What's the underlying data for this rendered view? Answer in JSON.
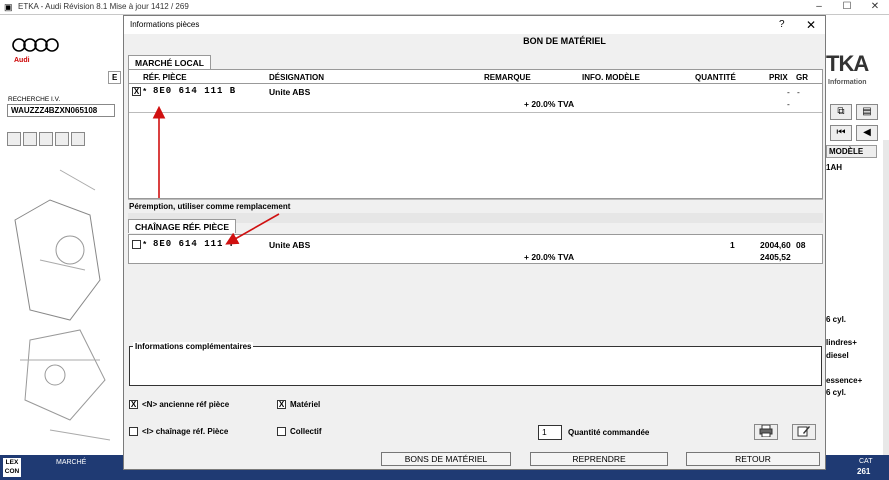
{
  "app": {
    "title": "ETKA - Audi Révision 8.1 Mise à jour 1412 / 269",
    "logo_text": "Audi",
    "search_label": "RECHERCHE I.V.",
    "vin_value": "WAUZZZ4BZXN065108",
    "tab_e": "E",
    "brand_partial": "TKA",
    "brand_sub": "Information",
    "model_col": "MODÈLE",
    "right_texts": [
      "1AH",
      "6 cyl.",
      "lindres+",
      "diesel",
      "essence+",
      "6 cyl."
    ],
    "bottom": {
      "lex": "LEX",
      "con": "CON",
      "marche": "MARCHÉ",
      "cat": "CAT",
      "cat_num": "261"
    }
  },
  "dialog": {
    "title": "Informations pièces",
    "help": "?",
    "close": "✕",
    "heading": "BON DE MATÉRIEL",
    "tab_local": "MARCHÉ LOCAL",
    "columns": {
      "ref": "RÉF. PIÈCE",
      "designation": "DÉSIGNATION",
      "remarque": "REMARQUE",
      "info": "INFO. MODÈLE",
      "quantite": "QUANTITÉ",
      "prix": "PRIX",
      "gr": "GR"
    },
    "row1": {
      "mark": "X",
      "star": "*",
      "ref": "8E0 614 111 B",
      "designation": "Unite ABS",
      "tva": "+ 20.0% TVA",
      "prix1": "-",
      "gr": "-",
      "prix2": "-"
    },
    "peremption": "Péremption, utiliser comme remplacement",
    "tab_chain": "CHAÎNAGE RÉF. PIÈCE",
    "row2": {
      "mark": "",
      "star": "*",
      "ref": "8E0 614 111 F",
      "designation": "Unite ABS",
      "tva": "+ 20.0% TVA",
      "quantite": "1",
      "prix1": "2004,60",
      "gr": "08",
      "prix2": "2405,52"
    },
    "info_label": "Informations complémentaires",
    "opt_ancienne": "<N> ancienne réf pièce",
    "opt_materiel": "Matériel",
    "opt_chainage": "<I> chaînage réf. Pièce",
    "opt_collectif": "Collectif",
    "check_ancienne": "X",
    "check_materiel": "X",
    "qty_value": "1",
    "qty_label": "Quantité commandée",
    "btn_bons": "BONS DE MATÉRIEL",
    "btn_reprendre": "REPRENDRE",
    "btn_retour": "RETOUR"
  },
  "colors": {
    "arrow": "#d01010",
    "bottom_bar": "#1f3a73"
  }
}
